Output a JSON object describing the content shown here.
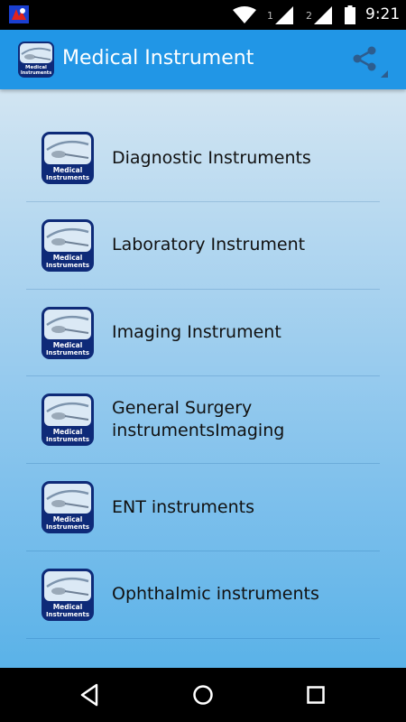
{
  "status_bar": {
    "time": "9:21",
    "sim1_label": "1",
    "sim2_label": "2",
    "icons": [
      "app-notification-icon",
      "wifi-icon",
      "signal-icon",
      "signal-icon",
      "battery-icon"
    ]
  },
  "app_bar": {
    "title": "Medical Instrument",
    "logo_icon": "medical-instruments-logo",
    "logo_text_1": "Medical",
    "logo_text_2": "Instruments",
    "action_icon": "share-icon",
    "color": "#2196e6"
  },
  "list": {
    "thumb_text_1": "Medical",
    "thumb_text_2": "Instruments",
    "items": [
      {
        "label": "Diagnostic Instruments"
      },
      {
        "label": "Laboratory Instrument"
      },
      {
        "label": "Imaging Instrument"
      },
      {
        "label": "General Surgery instrumentsImaging"
      },
      {
        "label": "ENT instruments"
      },
      {
        "label": "Ophthalmic instruments"
      }
    ]
  },
  "nav_bar": {
    "icons": [
      "back-icon",
      "home-icon",
      "recents-icon"
    ]
  }
}
